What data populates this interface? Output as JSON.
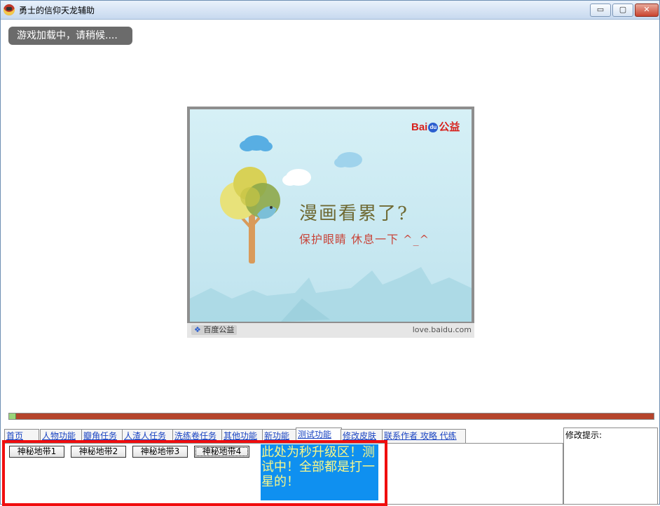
{
  "window": {
    "title": "勇士的信仰天龙辅助",
    "minimize": "▭",
    "maximize": "▢",
    "close": "✕"
  },
  "loading": {
    "text": "游戏加载中，请稍候...."
  },
  "ad": {
    "logo_prefix": "Bai",
    "logo_paw": "du",
    "logo_suffix": "公益",
    "headline": "漫画看累了?",
    "subline": "保护眼睛  休息一下 ^_^",
    "badge": "百度公益",
    "url": "love.baidu.com"
  },
  "progress": {
    "value": 0.01
  },
  "tabs": [
    {
      "label": "首页"
    },
    {
      "label": "人物功能"
    },
    {
      "label": "瓣角任务"
    },
    {
      "label": "人渣人任务"
    },
    {
      "label": "洗练卷任务"
    },
    {
      "label": "其他功能"
    },
    {
      "label": "新功能"
    },
    {
      "label": "测试功能"
    },
    {
      "label": "修改皮肤"
    },
    {
      "label": "联系作者 攻略 代练"
    }
  ],
  "active_tab": "测试功能",
  "buttons": [
    {
      "label": "神秘地带1"
    },
    {
      "label": "神秘地带2"
    },
    {
      "label": "神秘地带3"
    },
    {
      "label": "神秘地带4"
    }
  ],
  "notice": {
    "text": "此处为秒升级区！测试中！全部都是打一星的！"
  },
  "side": {
    "label": "修改提示:"
  },
  "colors": {
    "progress_track": "#b5442c",
    "progress_fill": "#9ad47a",
    "notice_bg": "#0f90f0",
    "notice_text": "#f7f78a",
    "frame": "#f00e0e"
  }
}
